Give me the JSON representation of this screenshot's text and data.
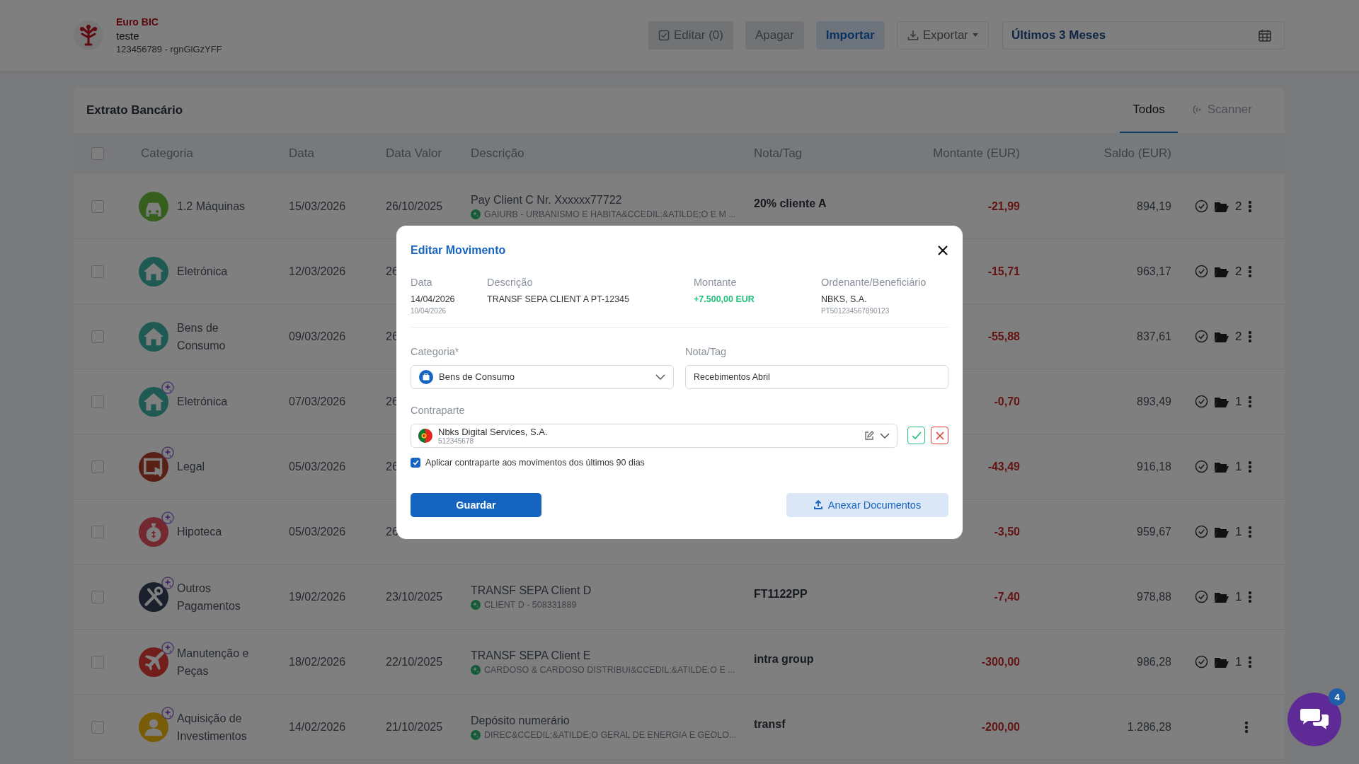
{
  "header": {
    "bank": "Euro BIC",
    "name": "teste",
    "account": "123456789 - rgnGlGzYFF",
    "buttons": [
      {
        "kind": "edit",
        "label": "Editar (0)"
      },
      {
        "kind": "plain",
        "label": "Apagar"
      },
      {
        "kind": "primary",
        "label": "Importar"
      },
      {
        "kind": "export",
        "label": "Exportar"
      }
    ],
    "period": "Últimos 3 Meses"
  },
  "statement": {
    "title": "Extrato Bancário",
    "tabs": [
      {
        "label": "Todos",
        "selected": true
      },
      {
        "label": "Scanner",
        "selected": false
      }
    ],
    "columns": [
      "Categoria",
      "Data",
      "Data Valor",
      "Descrição",
      "Nota/Tag",
      "Montante (EUR)",
      "Saldo (EUR)"
    ],
    "select_all": {
      "checked": false
    },
    "rows": [
      {
        "checked": false,
        "kind": "car",
        "ai": false,
        "category": "1.2 Máquinas",
        "date": "15/03/2026",
        "value_date": "26/10/2025",
        "description": "Pay Client C Nr. Xxxxxx77722",
        "detail": "GAIURB - URBANISMO E HABITA&CCEDIL;&ATILDE;O E M ...",
        "note": "20% cliente A",
        "amount": "-21,99",
        "balance": "894,19",
        "documents": "2"
      },
      {
        "checked": false,
        "kind": "house",
        "ai": false,
        "category": "Eletrónica",
        "date": "12/03/2026",
        "value_date": "26",
        "amount": "-15,71",
        "balance": "963,17",
        "documents": "2"
      },
      {
        "checked": false,
        "kind": "house",
        "ai": false,
        "category": "Bens de Consumo",
        "date": "09/03/2026",
        "value_date": "26",
        "amount": "-55,88",
        "balance": "837,61",
        "documents": "2"
      },
      {
        "checked": false,
        "kind": "house",
        "ai": true,
        "category": "Eletrónica",
        "date": "07/03/2026",
        "value_date": "26",
        "amount": "-0,70",
        "balance": "893,49",
        "documents": "1"
      },
      {
        "checked": false,
        "kind": "screen",
        "ai": true,
        "category": "Legal",
        "date": "05/03/2026",
        "value_date": "26",
        "amount": "-43,49",
        "balance": "916,18",
        "documents": "1"
      },
      {
        "checked": false,
        "kind": "moneybag",
        "ai": true,
        "category": "Hipoteca",
        "date": "05/03/2026",
        "value_date": "26",
        "amount": "-3,50",
        "balance": "959,67",
        "documents": "1"
      },
      {
        "checked": false,
        "kind": "tools",
        "ai": true,
        "category": "Outros Pagamentos",
        "date": "19/02/2026",
        "value_date": "23/10/2025",
        "description": "TRANSF SEPA Client D",
        "detail": "CLIENT D - 508331889",
        "note": "FT1122PP",
        "amount": "-7,40",
        "balance": "978,88",
        "documents": "1"
      },
      {
        "checked": false,
        "kind": "plane",
        "ai": true,
        "category": "Manutenção e Peças",
        "date": "18/02/2026",
        "value_date": "22/10/2025",
        "description": "TRANSF SEPA Client E",
        "detail": "CARDOSO & CARDOSO DISTRIBUI&CCEDIL;&ATILDE;O E ...",
        "note": "intra group",
        "amount": "-300,00",
        "balance": "986,28",
        "documents": "1"
      },
      {
        "checked": false,
        "kind": "person",
        "ai": true,
        "category": "Aquisição de Investimentos",
        "date": "14/02/2026",
        "value_date": "21/10/2025",
        "description": "Depósito numerário",
        "detail": "DIREC&CCEDIL;&ATILDE;O GERAL DE ENERGIA E GEOLO...",
        "note": "transf",
        "amount": "-200,00",
        "balance": "1.286,28"
      }
    ]
  },
  "modal": {
    "title": "Editar Movimento",
    "info": [
      {
        "kind": "text",
        "label": "Data",
        "value": "14/04/2026",
        "sub": "10/04/2026"
      },
      {
        "kind": "text",
        "label": "Descrição",
        "value": "TRANSF SEPA CLIENT A PT-12345"
      },
      {
        "kind": "amount",
        "label": "Montante",
        "value": "+7.500,00 EUR"
      },
      {
        "kind": "text",
        "label": "Ordenante/Beneficiário",
        "value": "NBKS, S.A.",
        "sub": "PT501234567890123"
      }
    ],
    "category": {
      "label": "Categoria*",
      "value": "Bens de Consumo"
    },
    "note": {
      "label": "Nota/Tag",
      "value": "Recebimentos Abril"
    },
    "counterparty": {
      "label": "Contraparte",
      "name": "Nbks Digital Services, S.A.",
      "nif": "512345678"
    },
    "apply": {
      "label": "Aplicar contraparte aos movimentos dos últimos 90 dias",
      "checked": true
    },
    "save": "Guardar",
    "attach": "Anexar Documentos"
  },
  "chat": {
    "badge": "4"
  }
}
